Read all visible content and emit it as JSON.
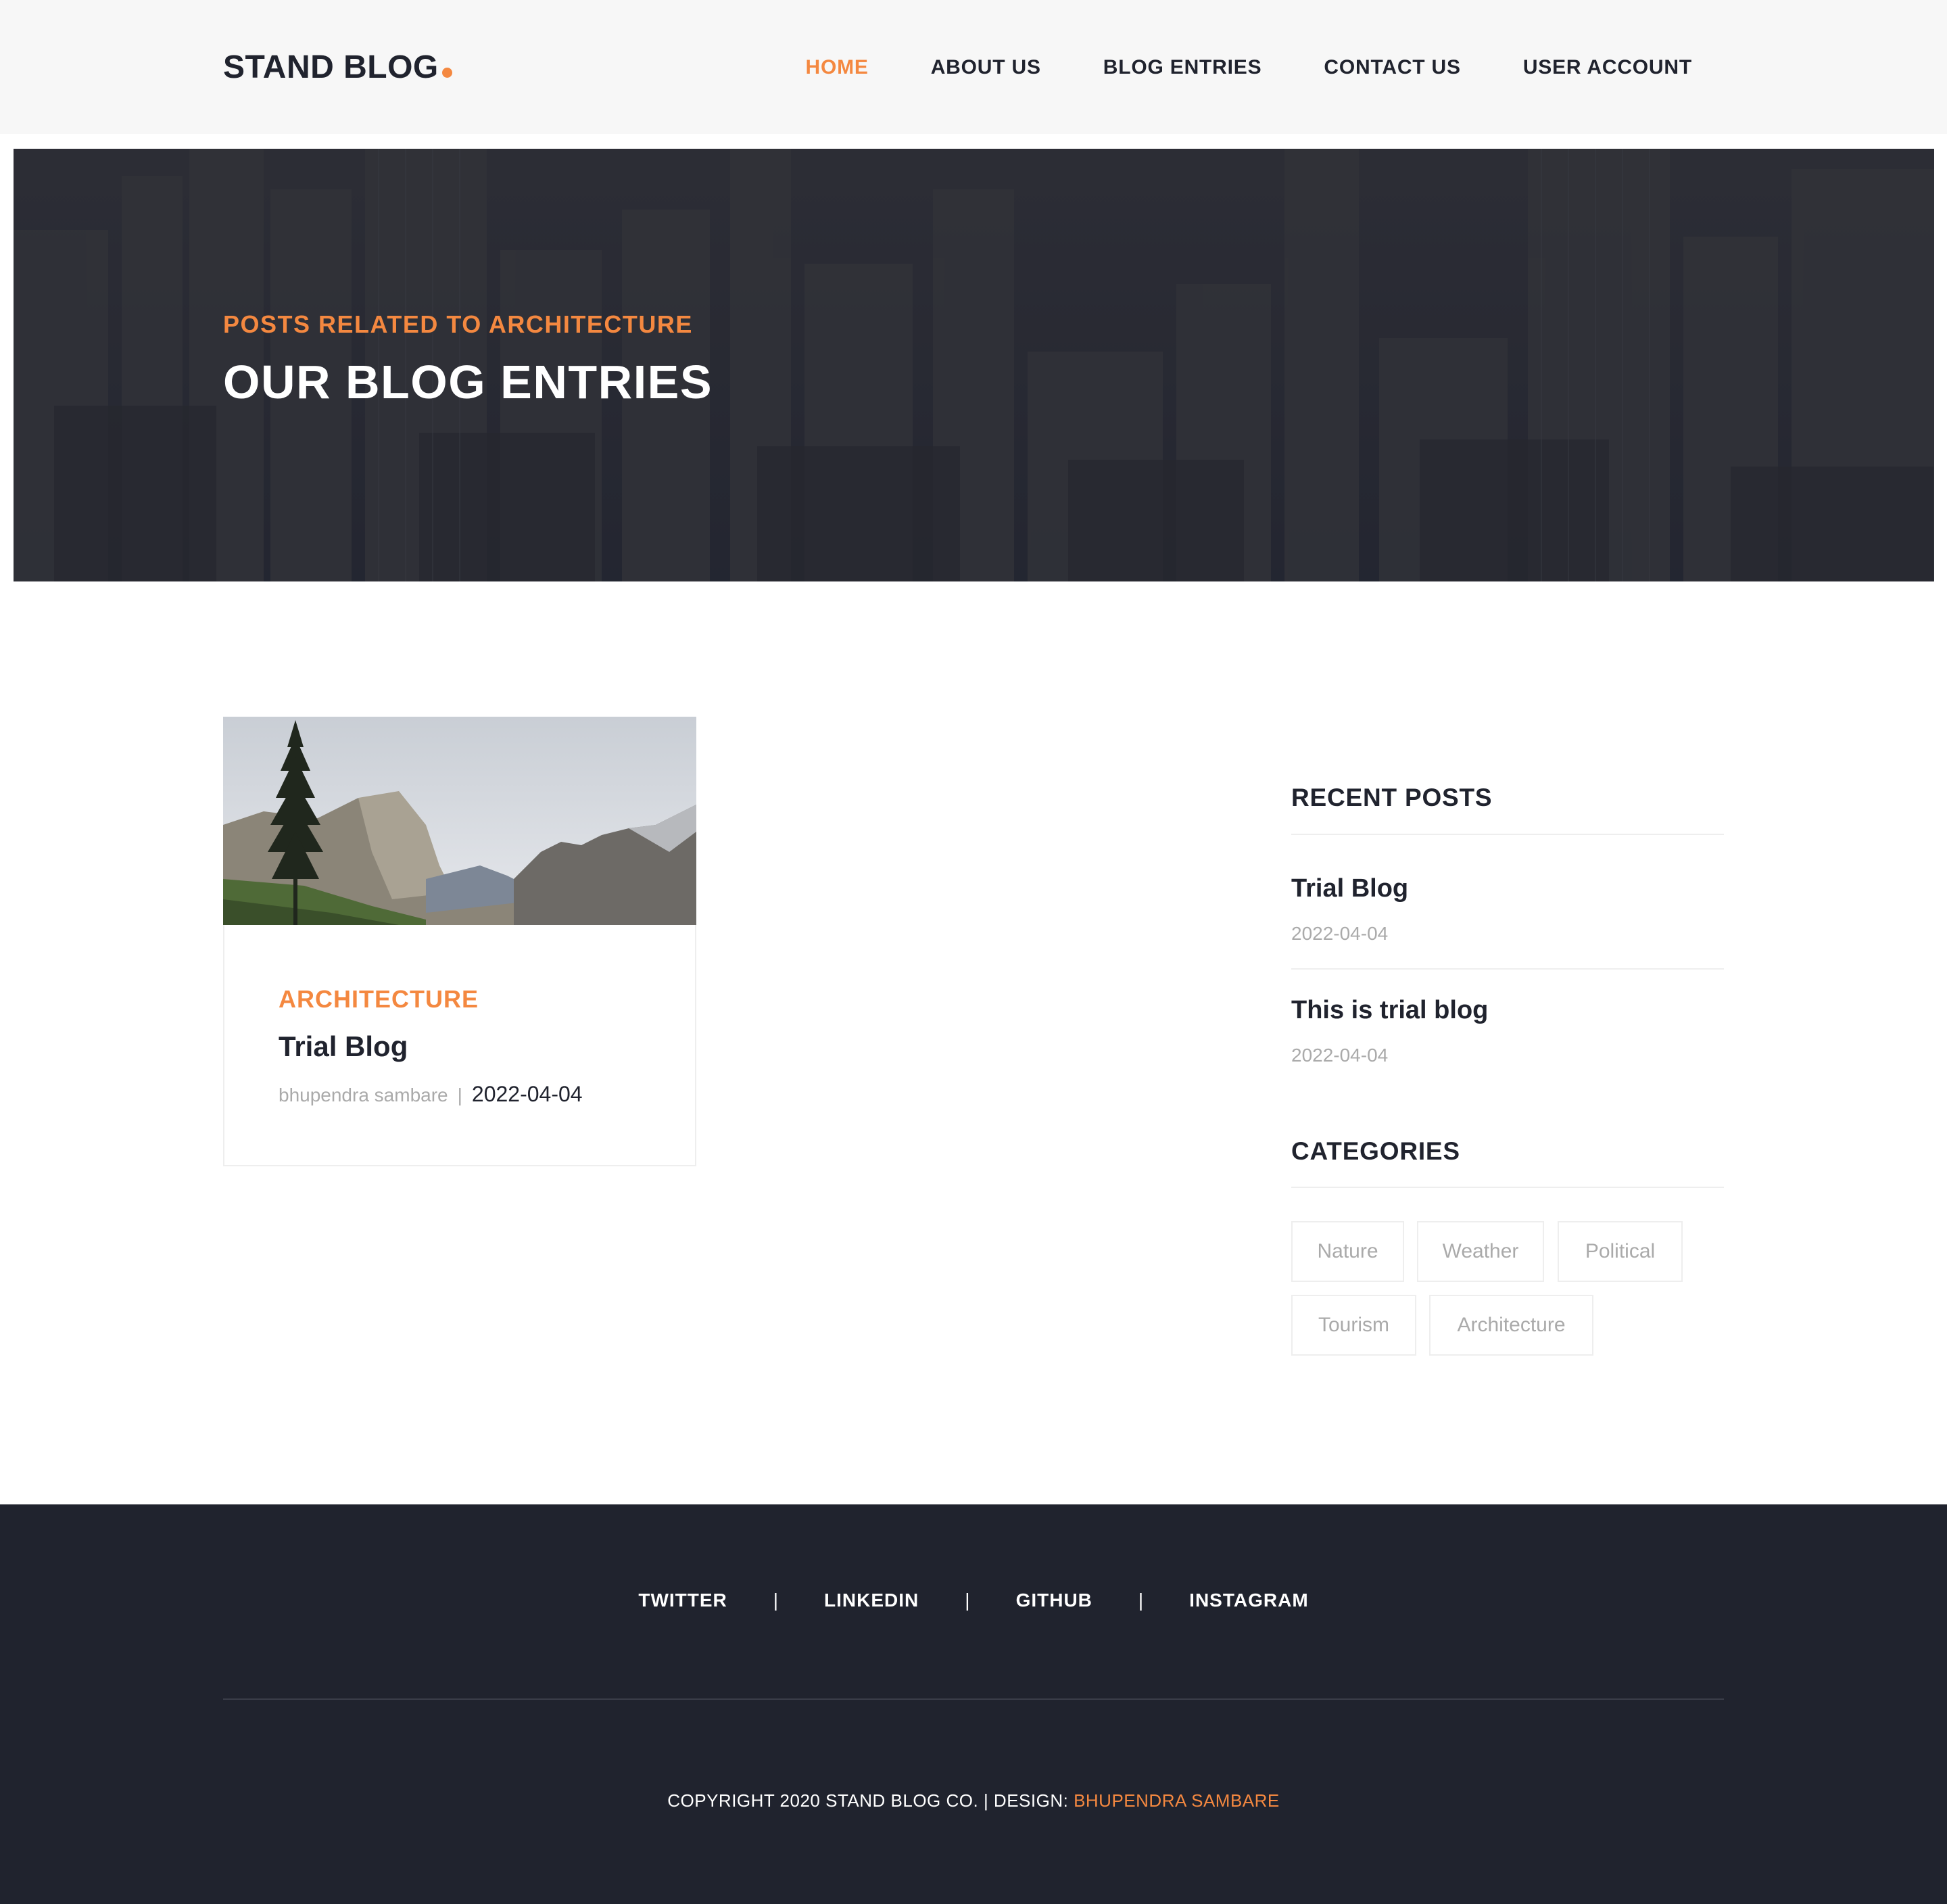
{
  "brand": {
    "name": "STAND BLOG",
    "accent": "#f48840",
    "dark": "#20232e"
  },
  "nav": {
    "items": [
      {
        "label": "HOME",
        "active": true
      },
      {
        "label": "ABOUT US",
        "active": false
      },
      {
        "label": "BLOG ENTRIES",
        "active": false
      },
      {
        "label": "CONTACT US",
        "active": false
      },
      {
        "label": "USER ACCOUNT",
        "active": false
      }
    ]
  },
  "hero": {
    "subtitle": "POSTS RELATED TO ARCHITECTURE",
    "title": "OUR BLOG ENTRIES"
  },
  "post": {
    "category": "ARCHITECTURE",
    "title": "Trial Blog",
    "author": "bhupendra sambare",
    "separator": "|",
    "date": "2022-04-04"
  },
  "sidebar": {
    "recent_heading": "RECENT POSTS",
    "recent_posts": [
      {
        "title": "Trial Blog",
        "date": "2022-04-04"
      },
      {
        "title": "This is trial blog",
        "date": "2022-04-04"
      }
    ],
    "categories_heading": "CATEGORIES",
    "categories": [
      "Nature",
      "Weather",
      "Political",
      "Tourism",
      "Architecture"
    ]
  },
  "footer": {
    "social": [
      "TWITTER",
      "LINKEDIN",
      "GITHUB",
      "INSTAGRAM"
    ],
    "separator": "|",
    "copyright_prefix": "COPYRIGHT 2020 STAND BLOG CO. | DESIGN: ",
    "designer": "BHUPENDRA SAMBARE"
  }
}
